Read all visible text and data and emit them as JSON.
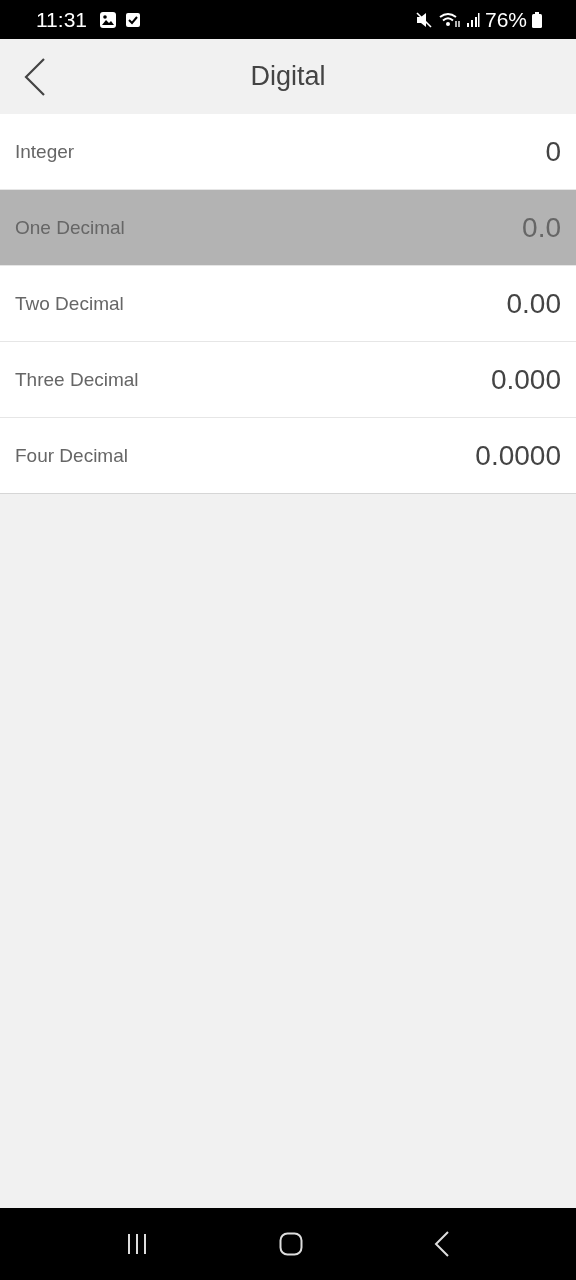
{
  "status_bar": {
    "time": "11:31",
    "battery": "76%"
  },
  "header": {
    "title": "Digital"
  },
  "options": [
    {
      "label": "Integer",
      "value": "0",
      "selected": false
    },
    {
      "label": "One Decimal",
      "value": "0.0",
      "selected": true
    },
    {
      "label": "Two Decimal",
      "value": "0.00",
      "selected": false
    },
    {
      "label": "Three Decimal",
      "value": "0.000",
      "selected": false
    },
    {
      "label": "Four Decimal",
      "value": "0.0000",
      "selected": false
    }
  ]
}
